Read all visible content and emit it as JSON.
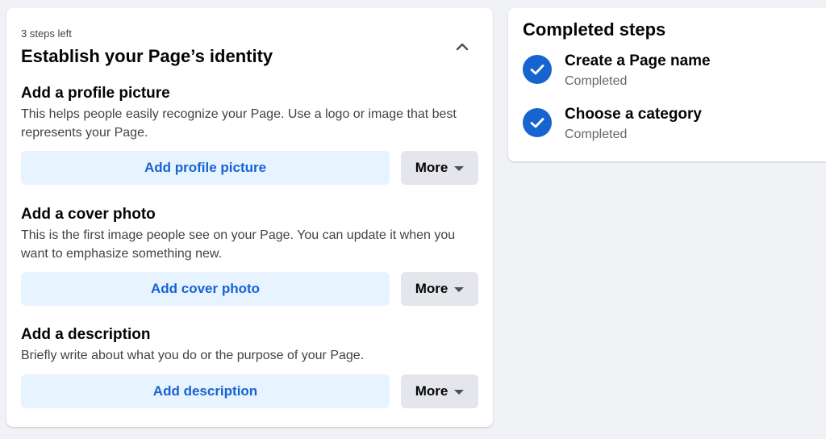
{
  "setup": {
    "steps_left": "3 steps left",
    "title": "Establish your Page’s identity",
    "collapse_icon": "chevron-up-icon",
    "sections": [
      {
        "title": "Add a profile picture",
        "description": "This helps people easily recognize your Page. Use a logo or image that best represents your Page.",
        "action_label": "Add profile picture",
        "more_label": "More"
      },
      {
        "title": "Add a cover photo",
        "description": "This is the first image people see on your Page. You can update it when you want to emphasize something new.",
        "action_label": "Add cover photo",
        "more_label": "More"
      },
      {
        "title": "Add a description",
        "description": "Briefly write about what you do or the purpose of your Page.",
        "action_label": "Add description",
        "more_label": "More"
      }
    ]
  },
  "completed": {
    "title": "Completed steps",
    "items": [
      {
        "name": "Create a Page name",
        "status": "Completed",
        "icon": "checkmark-circle-icon"
      },
      {
        "name": "Choose a category",
        "status": "Completed",
        "icon": "checkmark-circle-icon"
      }
    ]
  },
  "colors": {
    "accent": "#1763cf",
    "primary_button_bg": "#e7f3ff",
    "secondary_button_bg": "#e4e6eb",
    "page_bg": "#f0f2f5"
  }
}
